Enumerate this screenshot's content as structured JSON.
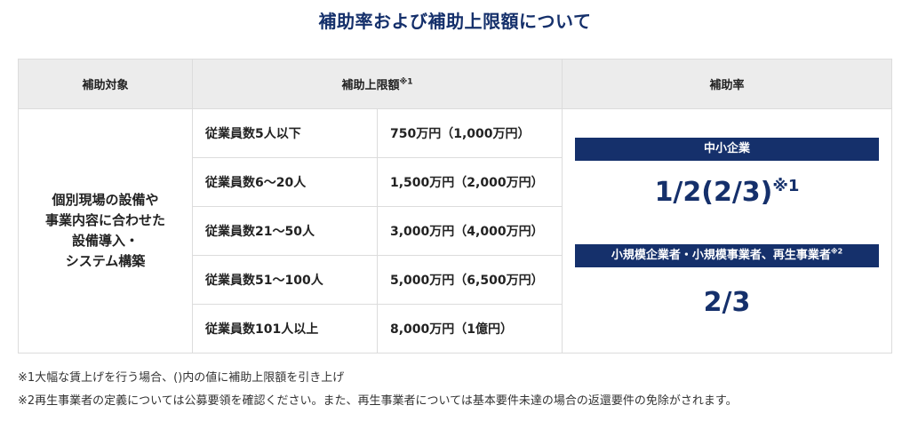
{
  "title": "補助率および補助上限額について",
  "table": {
    "headers": {
      "target": "補助対象",
      "limit": "補助上限額",
      "limit_note": "※1",
      "rate": "補助率"
    },
    "target_lines": [
      "個別現場の設備や",
      "事業内容に合わせた",
      "設備導入・",
      "システム構築"
    ],
    "rows": [
      {
        "employees": "従業員数5人以下",
        "limit": "750万円（1,000万円）"
      },
      {
        "employees": "従業員数6～20人",
        "limit": "1,500万円（2,000万円）"
      },
      {
        "employees": "従業員数21～50人",
        "limit": "3,000万円（4,000万円）"
      },
      {
        "employees": "従業員数51～100人",
        "limit": "5,000万円（6,500万円）"
      },
      {
        "employees": "従業員数101人以上",
        "limit": "8,000万円（1億円）"
      }
    ],
    "rates": {
      "sme_label": "中小企業",
      "sme_value": "1/2(2/3)",
      "sme_value_note": "※1",
      "small_label": "小規模企業者・小規模事業者、再生事業者",
      "small_label_note": "※2",
      "small_value": "2/3"
    }
  },
  "notes": [
    "※1大幅な賃上げを行う場合、()内の値に補助上限額を引き上げ",
    "※2再生事業者の定義については公募要領を確認ください。また、再生事業者については基本要件未達の場合の返還要件の免除がされます。"
  ],
  "colors": {
    "brand_navy": "#15306b",
    "header_gray": "#ececec",
    "border": "#dcdcdc"
  }
}
